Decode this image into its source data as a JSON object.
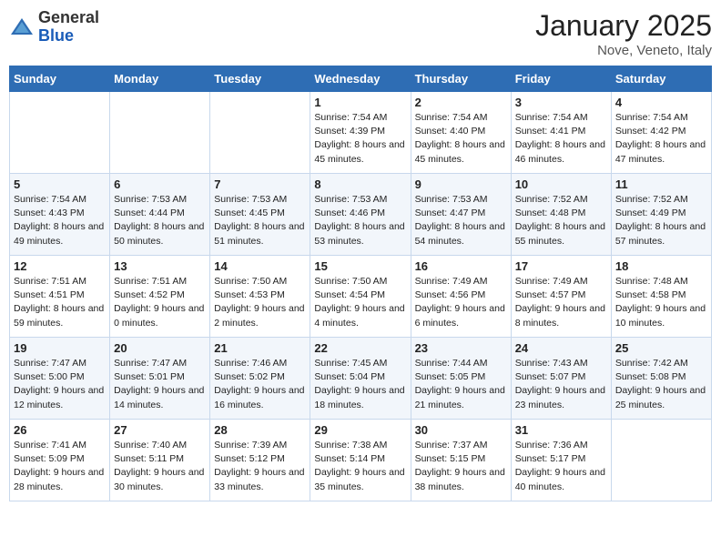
{
  "header": {
    "logo": {
      "general": "General",
      "blue": "Blue"
    },
    "title": "January 2025",
    "location": "Nove, Veneto, Italy"
  },
  "weekdays": [
    "Sunday",
    "Monday",
    "Tuesday",
    "Wednesday",
    "Thursday",
    "Friday",
    "Saturday"
  ],
  "weeks": [
    [
      {
        "day": "",
        "info": ""
      },
      {
        "day": "",
        "info": ""
      },
      {
        "day": "",
        "info": ""
      },
      {
        "day": "1",
        "info": "Sunrise: 7:54 AM\nSunset: 4:39 PM\nDaylight: 8 hours and 45 minutes."
      },
      {
        "day": "2",
        "info": "Sunrise: 7:54 AM\nSunset: 4:40 PM\nDaylight: 8 hours and 45 minutes."
      },
      {
        "day": "3",
        "info": "Sunrise: 7:54 AM\nSunset: 4:41 PM\nDaylight: 8 hours and 46 minutes."
      },
      {
        "day": "4",
        "info": "Sunrise: 7:54 AM\nSunset: 4:42 PM\nDaylight: 8 hours and 47 minutes."
      }
    ],
    [
      {
        "day": "5",
        "info": "Sunrise: 7:54 AM\nSunset: 4:43 PM\nDaylight: 8 hours and 49 minutes."
      },
      {
        "day": "6",
        "info": "Sunrise: 7:53 AM\nSunset: 4:44 PM\nDaylight: 8 hours and 50 minutes."
      },
      {
        "day": "7",
        "info": "Sunrise: 7:53 AM\nSunset: 4:45 PM\nDaylight: 8 hours and 51 minutes."
      },
      {
        "day": "8",
        "info": "Sunrise: 7:53 AM\nSunset: 4:46 PM\nDaylight: 8 hours and 53 minutes."
      },
      {
        "day": "9",
        "info": "Sunrise: 7:53 AM\nSunset: 4:47 PM\nDaylight: 8 hours and 54 minutes."
      },
      {
        "day": "10",
        "info": "Sunrise: 7:52 AM\nSunset: 4:48 PM\nDaylight: 8 hours and 55 minutes."
      },
      {
        "day": "11",
        "info": "Sunrise: 7:52 AM\nSunset: 4:49 PM\nDaylight: 8 hours and 57 minutes."
      }
    ],
    [
      {
        "day": "12",
        "info": "Sunrise: 7:51 AM\nSunset: 4:51 PM\nDaylight: 8 hours and 59 minutes."
      },
      {
        "day": "13",
        "info": "Sunrise: 7:51 AM\nSunset: 4:52 PM\nDaylight: 9 hours and 0 minutes."
      },
      {
        "day": "14",
        "info": "Sunrise: 7:50 AM\nSunset: 4:53 PM\nDaylight: 9 hours and 2 minutes."
      },
      {
        "day": "15",
        "info": "Sunrise: 7:50 AM\nSunset: 4:54 PM\nDaylight: 9 hours and 4 minutes."
      },
      {
        "day": "16",
        "info": "Sunrise: 7:49 AM\nSunset: 4:56 PM\nDaylight: 9 hours and 6 minutes."
      },
      {
        "day": "17",
        "info": "Sunrise: 7:49 AM\nSunset: 4:57 PM\nDaylight: 9 hours and 8 minutes."
      },
      {
        "day": "18",
        "info": "Sunrise: 7:48 AM\nSunset: 4:58 PM\nDaylight: 9 hours and 10 minutes."
      }
    ],
    [
      {
        "day": "19",
        "info": "Sunrise: 7:47 AM\nSunset: 5:00 PM\nDaylight: 9 hours and 12 minutes."
      },
      {
        "day": "20",
        "info": "Sunrise: 7:47 AM\nSunset: 5:01 PM\nDaylight: 9 hours and 14 minutes."
      },
      {
        "day": "21",
        "info": "Sunrise: 7:46 AM\nSunset: 5:02 PM\nDaylight: 9 hours and 16 minutes."
      },
      {
        "day": "22",
        "info": "Sunrise: 7:45 AM\nSunset: 5:04 PM\nDaylight: 9 hours and 18 minutes."
      },
      {
        "day": "23",
        "info": "Sunrise: 7:44 AM\nSunset: 5:05 PM\nDaylight: 9 hours and 21 minutes."
      },
      {
        "day": "24",
        "info": "Sunrise: 7:43 AM\nSunset: 5:07 PM\nDaylight: 9 hours and 23 minutes."
      },
      {
        "day": "25",
        "info": "Sunrise: 7:42 AM\nSunset: 5:08 PM\nDaylight: 9 hours and 25 minutes."
      }
    ],
    [
      {
        "day": "26",
        "info": "Sunrise: 7:41 AM\nSunset: 5:09 PM\nDaylight: 9 hours and 28 minutes."
      },
      {
        "day": "27",
        "info": "Sunrise: 7:40 AM\nSunset: 5:11 PM\nDaylight: 9 hours and 30 minutes."
      },
      {
        "day": "28",
        "info": "Sunrise: 7:39 AM\nSunset: 5:12 PM\nDaylight: 9 hours and 33 minutes."
      },
      {
        "day": "29",
        "info": "Sunrise: 7:38 AM\nSunset: 5:14 PM\nDaylight: 9 hours and 35 minutes."
      },
      {
        "day": "30",
        "info": "Sunrise: 7:37 AM\nSunset: 5:15 PM\nDaylight: 9 hours and 38 minutes."
      },
      {
        "day": "31",
        "info": "Sunrise: 7:36 AM\nSunset: 5:17 PM\nDaylight: 9 hours and 40 minutes."
      },
      {
        "day": "",
        "info": ""
      }
    ]
  ]
}
